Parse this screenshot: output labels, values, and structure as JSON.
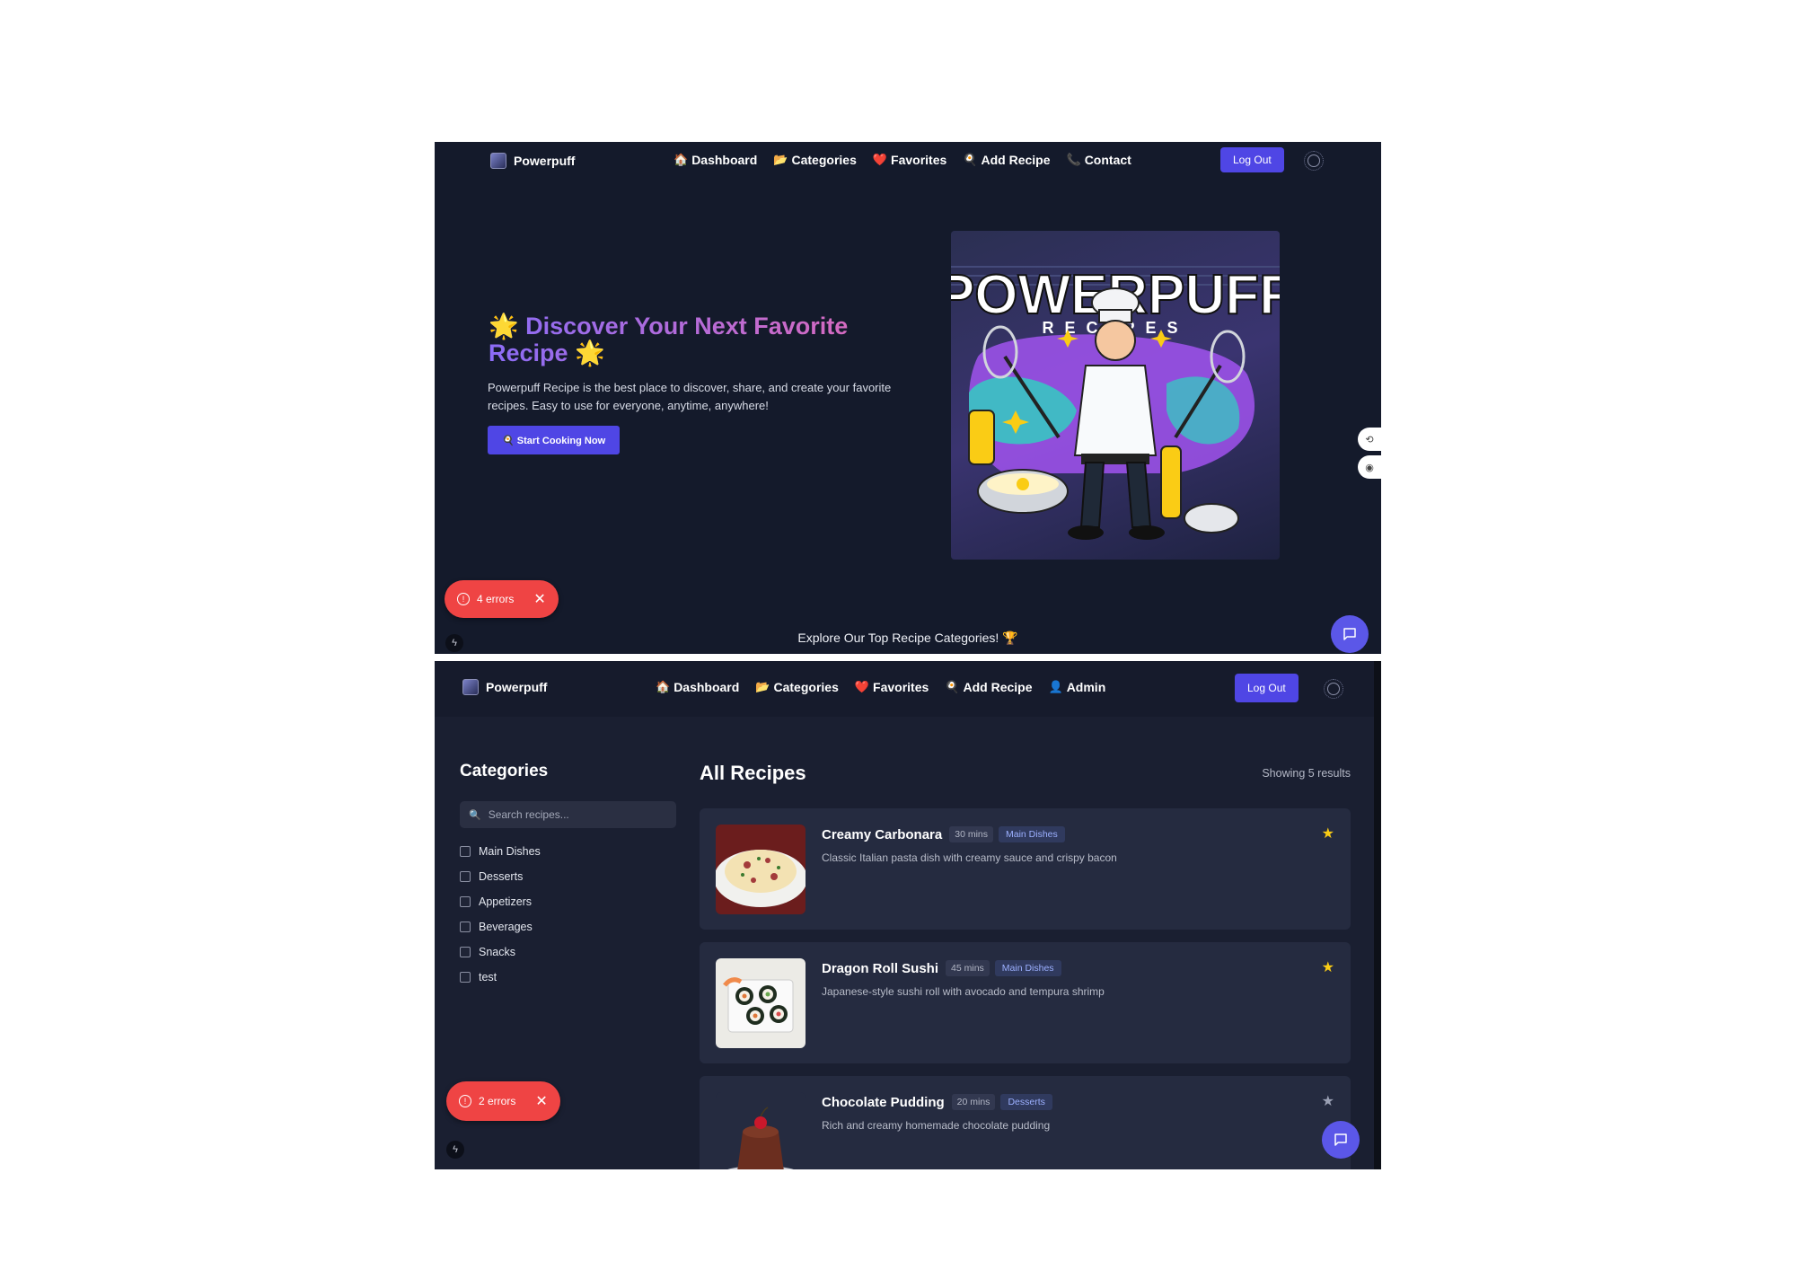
{
  "home": {
    "brand": "Powerpuff",
    "nav": [
      {
        "icon": "🏠",
        "label": "Dashboard"
      },
      {
        "icon": "📂",
        "label": "Categories"
      },
      {
        "icon": "❤️",
        "label": "Favorites"
      },
      {
        "icon": "🍳",
        "label": "Add Recipe"
      },
      {
        "icon": "📞",
        "label": "Contact"
      }
    ],
    "logout": "Log Out",
    "hero_star": "🌟",
    "hero_title": "Discover Your Next Favorite Recipe",
    "hero_desc": "Powerpuff Recipe is the best place to discover, share, and create your favorite recipes. Easy to use for everyone, anytime, anywhere!",
    "start_button": "🍳 Start Cooking Now",
    "hero_image_text": "POWERPUFF",
    "hero_image_subtext": "RECIPES",
    "errors": "4 errors",
    "explore": "Explore Our Top Recipe Categories! 🏆"
  },
  "recipes": {
    "brand": "Powerpuff",
    "nav": [
      {
        "icon": "🏠",
        "label": "Dashboard"
      },
      {
        "icon": "📂",
        "label": "Categories"
      },
      {
        "icon": "❤️",
        "label": "Favorites"
      },
      {
        "icon": "🍳",
        "label": "Add Recipe"
      },
      {
        "icon": "👤",
        "label": "Admin"
      }
    ],
    "logout": "Log Out",
    "sidebar_title": "Categories",
    "search_placeholder": "Search recipes...",
    "categories": [
      "Main Dishes",
      "Desserts",
      "Appetizers",
      "Beverages",
      "Snacks",
      "test"
    ],
    "main_title": "All Recipes",
    "showing": "Showing 5 results",
    "items": [
      {
        "name": "Creamy Carbonara",
        "time": "30 mins",
        "tag": "Main Dishes",
        "desc": "Classic Italian pasta dish with creamy sauce and crispy bacon",
        "favorite": true
      },
      {
        "name": "Dragon Roll Sushi",
        "time": "45 mins",
        "tag": "Main Dishes",
        "desc": "Japanese-style sushi roll with avocado and tempura shrimp",
        "favorite": true
      },
      {
        "name": "Chocolate Pudding",
        "time": "20 mins",
        "tag": "Desserts",
        "desc": "Rich and creamy homemade chocolate pudding",
        "favorite": false
      }
    ],
    "errors": "2 errors"
  },
  "colors": {
    "accent": "#4f46e5",
    "star_active": "#facc15",
    "star_inactive": "#9aa0b4",
    "error": "#ef4444"
  }
}
